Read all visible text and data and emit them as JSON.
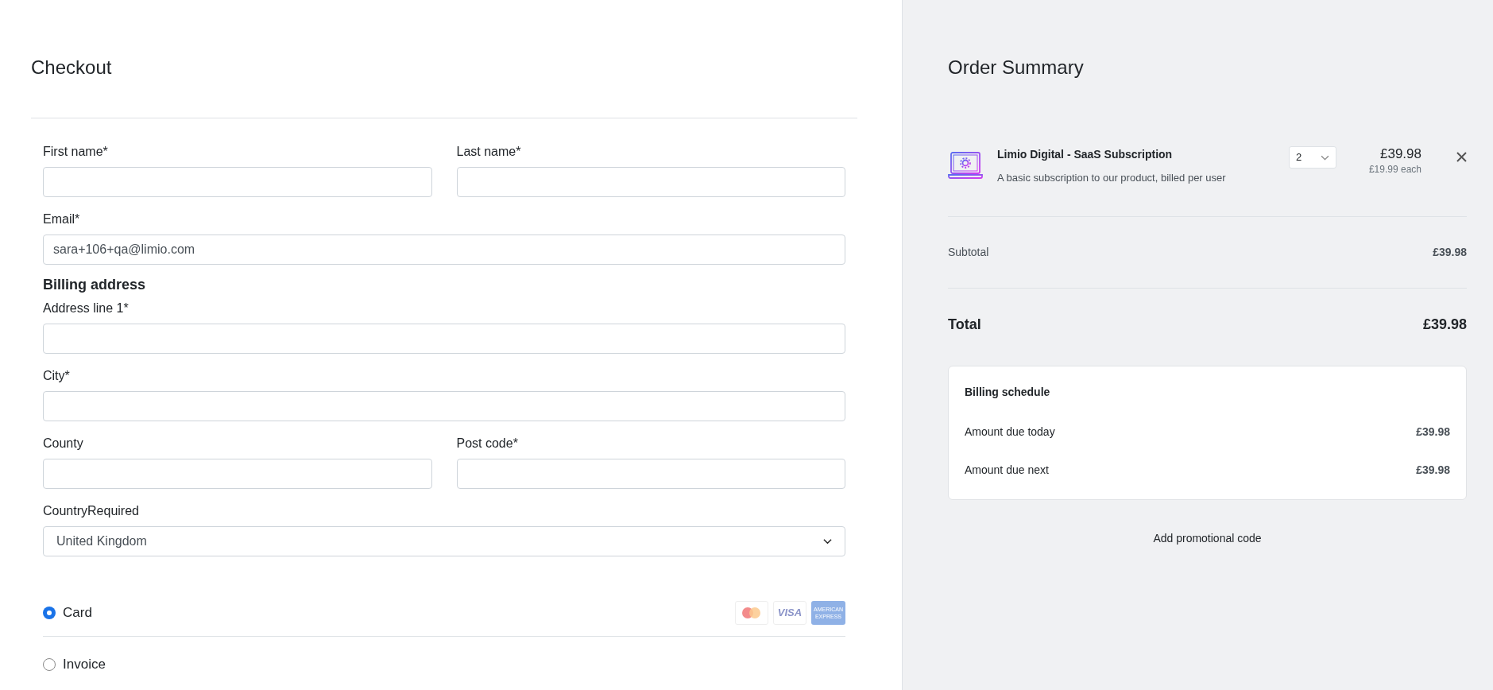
{
  "checkout": {
    "title": "Checkout",
    "rows": [
      {
        "kind": "pair",
        "fields": [
          {
            "label": "First name*"
          },
          {
            "label": "Last name*"
          }
        ]
      },
      {
        "kind": "single",
        "fields": [
          {
            "label": "Email*",
            "value": "sara+106+qa@limio.com"
          }
        ]
      },
      {
        "kind": "heading",
        "text": "Billing address"
      },
      {
        "kind": "single",
        "fields": [
          {
            "label": "Address line 1*"
          }
        ]
      },
      {
        "kind": "single",
        "fields": [
          {
            "label": "City*"
          }
        ]
      },
      {
        "kind": "pair",
        "fields": [
          {
            "label": "County"
          },
          {
            "label": "Post code*"
          }
        ]
      },
      {
        "kind": "select",
        "fields": [
          {
            "label": "CountryRequired",
            "value": "United Kingdom"
          }
        ]
      }
    ],
    "payment_methods": [
      {
        "label": "Card",
        "selected": true,
        "logos": [
          {
            "kind": "mastercard"
          },
          {
            "kind": "visa",
            "text": "VISA"
          },
          {
            "kind": "amex",
            "text": "AMERICAN EXPRESS"
          }
        ]
      },
      {
        "label": "Invoice",
        "selected": false
      }
    ]
  },
  "summary": {
    "title": "Order Summary",
    "item": {
      "name": "Limio Digital - SaaS Subscription",
      "description": "A basic subscription to our product, billed per user",
      "quantity": "2",
      "price": "£39.98",
      "unit_price": "£19.99 each"
    },
    "subtotal": {
      "label": "Subtotal",
      "value": "£39.98"
    },
    "total": {
      "label": "Total",
      "value": "£39.98"
    },
    "billing_schedule": {
      "title": "Billing schedule",
      "rows": [
        {
          "label": "Amount due today",
          "value": "£39.98"
        },
        {
          "label": "Amount due next",
          "value": "£39.98"
        }
      ]
    },
    "promo_link": "Add promotional code"
  }
}
